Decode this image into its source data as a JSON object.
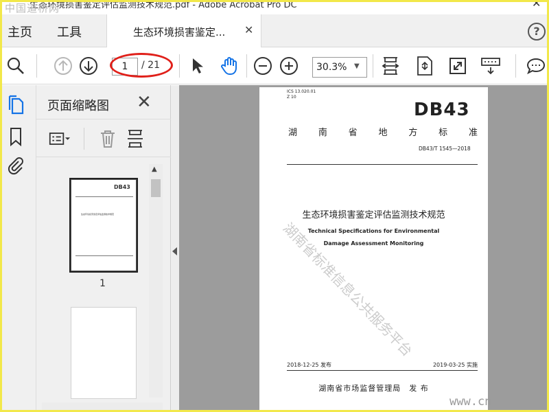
{
  "window": {
    "title": "生态环境损害鉴定评估监测技术规范.pdf - Adobe Acrobat Pro DC",
    "site_watermark": "中国道桥网"
  },
  "menubar": {
    "home": "主页",
    "tools": "工具",
    "document_tab": "生态环境损害鉴定...",
    "help": "?"
  },
  "toolbar": {
    "current_page": "1",
    "total_pages": "/ 21",
    "zoom": "30.3%"
  },
  "thumbnails_panel": {
    "title": "页面缩略图",
    "page_label": "1"
  },
  "document": {
    "ics": "ICS 13.020.01",
    "classification": "Z 10",
    "standard_code": "DB43",
    "province_line": [
      "湖",
      "南",
      "省",
      "地",
      "方",
      "标",
      "准"
    ],
    "standard_number": "DB43/T 1545—2018",
    "zh_title": "生态环境损害鉴定评估监测技术规范",
    "en_title_line1": "Technical Specifications for Environmental",
    "en_title_line2": "Damage Assessment Monitoring",
    "publish_date": "2018-12-25 发布",
    "implement_date": "2019-03-25 实施",
    "issuer": "湖南省市场监督管理局　发 布",
    "watermark": "湖南省标准信息公共服务平台",
    "site_url": "www.cn"
  },
  "colors": {
    "annotation_red": "#e0201a",
    "accent_blue": "#1473e6",
    "doc_background": "#9c9c9c"
  }
}
